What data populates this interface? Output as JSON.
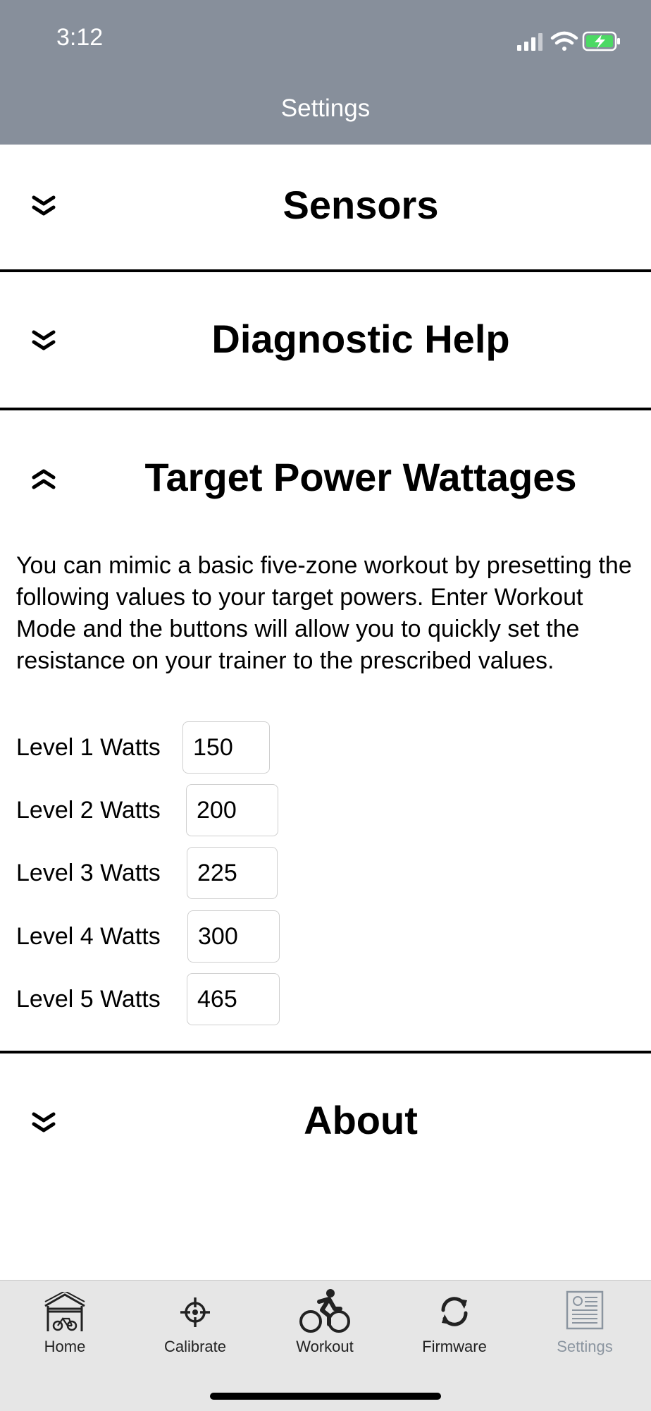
{
  "status_bar": {
    "time": "3:12"
  },
  "header": {
    "title": "Settings"
  },
  "sections": [
    {
      "title": "Sensors",
      "expanded": false
    },
    {
      "title": "Diagnostic Help",
      "expanded": false
    },
    {
      "title": "Target Power Wattages",
      "expanded": true
    },
    {
      "title": "About",
      "expanded": false
    }
  ],
  "target_power": {
    "description": "You can mimic a basic five-zone workout by presetting the following values to your target powers.  Enter Workout Mode and the buttons will allow you to quickly set the resistance on your trainer to the prescribed values.",
    "levels": [
      {
        "label": "Level 1 Watts",
        "value": "150"
      },
      {
        "label": "Level 2 Watts",
        "value": "200"
      },
      {
        "label": "Level 3 Watts",
        "value": "225"
      },
      {
        "label": "Level 4 Watts",
        "value": "300"
      },
      {
        "label": "Level 5 Watts",
        "value": "465"
      }
    ]
  },
  "tabbar": {
    "tabs": [
      {
        "label": "Home",
        "icon": "garage-bike-icon"
      },
      {
        "label": "Calibrate",
        "icon": "crosshair-icon"
      },
      {
        "label": "Workout",
        "icon": "cyclist-icon"
      },
      {
        "label": "Firmware",
        "icon": "refresh-icon"
      },
      {
        "label": "Settings",
        "icon": "settings-document-icon",
        "active": true
      }
    ]
  },
  "colors": {
    "header_bg": "#878f9b",
    "active_tab": "#8b95a0",
    "battery": "#4cd964"
  }
}
